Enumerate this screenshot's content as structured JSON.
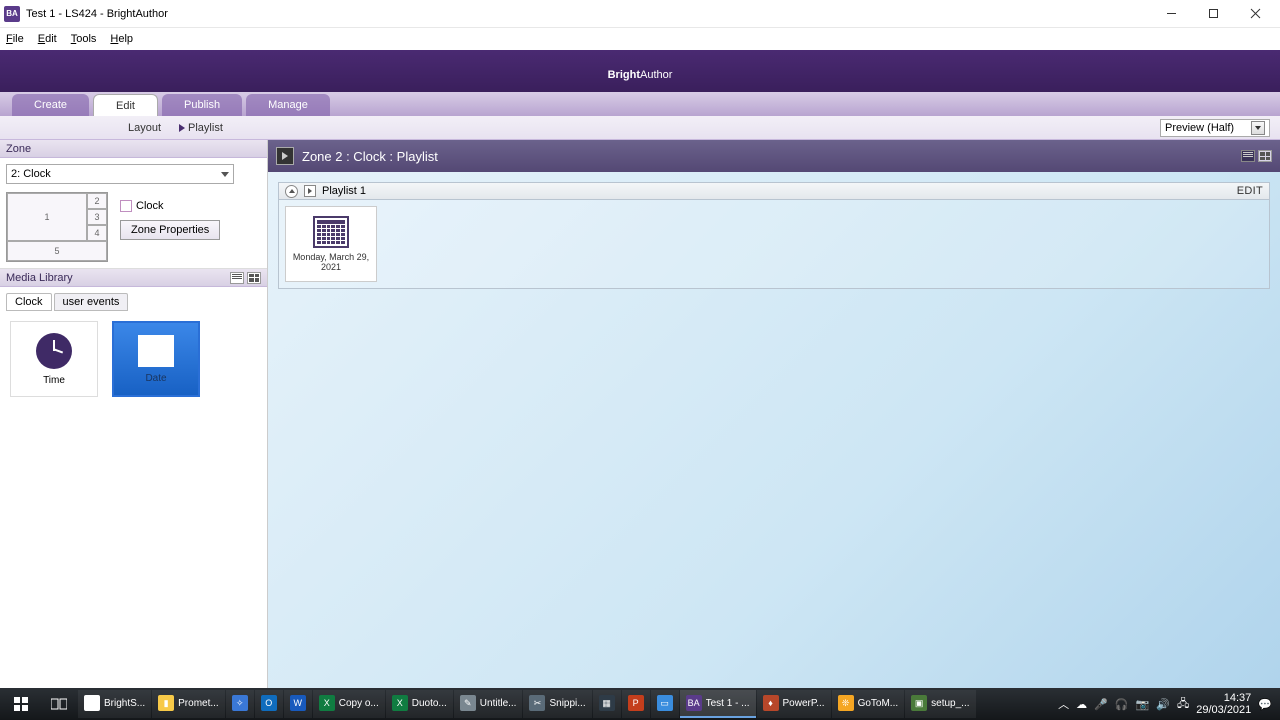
{
  "window": {
    "title": "Test 1 - LS424 - BrightAuthor",
    "app_badge": "BA"
  },
  "menubar": {
    "file": "File",
    "edit": "Edit",
    "tools": "Tools",
    "help": "Help"
  },
  "brand": {
    "prefix": "Bright",
    "suffix": "Author"
  },
  "main_tabs": {
    "create": "Create",
    "edit": "Edit",
    "publish": "Publish",
    "manage": "Manage"
  },
  "sub_toolbar": {
    "layout": "Layout",
    "playlist": "Playlist",
    "preview_label": "Preview (Half)"
  },
  "zone_panel": {
    "title": "Zone",
    "dropdown": "2: Clock",
    "cells": {
      "c1": "1",
      "c2": "2",
      "c3": "3",
      "c4": "4",
      "c5": "5"
    },
    "clock_check": "Clock",
    "props_btn": "Zone Properties"
  },
  "media_library": {
    "title": "Media Library",
    "tabs": {
      "clock": "Clock",
      "user_events": "user events"
    },
    "items": {
      "time": "Time",
      "date": "Date"
    }
  },
  "playlist": {
    "breadcrumb": "Zone 2 : Clock :  Playlist",
    "name": "Playlist 1",
    "edit": "EDIT",
    "item_caption": "Monday, March 29, 2021"
  },
  "taskbar": {
    "apps": [
      {
        "label": "BrightS...",
        "color": "#fff",
        "ic": "◉"
      },
      {
        "label": "Promet...",
        "color": "#f7c948",
        "ic": "▮"
      },
      {
        "label": "",
        "color": "#3a78d6",
        "ic": "✧"
      },
      {
        "label": "",
        "color": "#0f6cbd",
        "ic": "O"
      },
      {
        "label": "",
        "color": "#185abd",
        "ic": "W"
      },
      {
        "label": "Copy o...",
        "color": "#107c41",
        "ic": "X"
      },
      {
        "label": "Duoto...",
        "color": "#107c41",
        "ic": "X"
      },
      {
        "label": "Untitle...",
        "color": "#7a8790",
        "ic": "✎"
      },
      {
        "label": "Snippi...",
        "color": "#5a6b78",
        "ic": "✂"
      },
      {
        "label": "",
        "color": "#2e3b47",
        "ic": "▦"
      },
      {
        "label": "",
        "color": "#c43e1c",
        "ic": "P"
      },
      {
        "label": "",
        "color": "#3a8dde",
        "ic": "▭"
      },
      {
        "label": "Test 1 - ...",
        "color": "#5a3b8a",
        "ic": "BA"
      },
      {
        "label": "PowerP...",
        "color": "#b7472a",
        "ic": "♦"
      },
      {
        "label": "GoToM...",
        "color": "#f5a623",
        "ic": "❊"
      },
      {
        "label": "setup_...",
        "color": "#4a7a3a",
        "ic": "▣"
      }
    ],
    "time": "14:37",
    "date": "29/03/2021"
  }
}
